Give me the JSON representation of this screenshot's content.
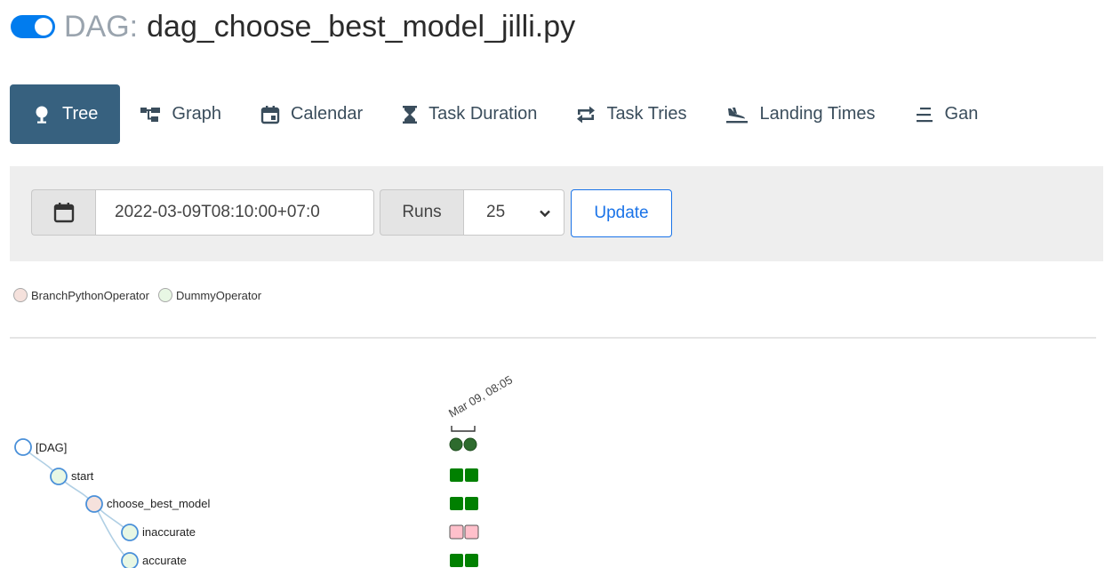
{
  "header": {
    "prefix": "DAG:",
    "dag_name": "dag_choose_best_model_jilli.py",
    "toggle_on": true,
    "accent_color": "#017cee"
  },
  "tabs": [
    {
      "label": "Tree",
      "icon": "tree-icon",
      "active": true
    },
    {
      "label": "Graph",
      "icon": "graph-icon",
      "active": false
    },
    {
      "label": "Calendar",
      "icon": "calendar-icon",
      "active": false
    },
    {
      "label": "Task Duration",
      "icon": "hourglass-icon",
      "active": false
    },
    {
      "label": "Task Tries",
      "icon": "retry-arrows-icon",
      "active": false
    },
    {
      "label": "Landing Times",
      "icon": "plane-landing-icon",
      "active": false
    },
    {
      "label": "Gan",
      "icon": "gantt-icon",
      "active": false
    }
  ],
  "filter": {
    "date_value": "2022-03-09T08:10:00+07:0",
    "runs_label": "Runs",
    "runs_value": "25",
    "update_label": "Update"
  },
  "legend": [
    {
      "label": "BranchPythonOperator",
      "color": "#f5e1dc"
    },
    {
      "label": "DummyOperator",
      "color": "#e8f7e4"
    }
  ],
  "tree": {
    "run_date_label": "Mar 09, 08:05",
    "nodes": [
      {
        "label": "[DAG]",
        "color": "#ffffff"
      },
      {
        "label": "start",
        "color": "#e8f7e4"
      },
      {
        "label": "choose_best_model",
        "color": "#f5e1dc"
      },
      {
        "label": "inaccurate",
        "color": "#e8f7e4"
      },
      {
        "label": "accurate",
        "color": "#e8f7e4"
      }
    ],
    "status_colors": {
      "success": "#008000",
      "skipped": "#ffc0cb",
      "dag_run_success": "#2e6b2e"
    },
    "instances": [
      [
        "dag_run_success",
        "dag_run_success"
      ],
      [
        "success",
        "success"
      ],
      [
        "success",
        "success"
      ],
      [
        "skipped",
        "skipped"
      ],
      [
        "success",
        "success"
      ]
    ]
  }
}
